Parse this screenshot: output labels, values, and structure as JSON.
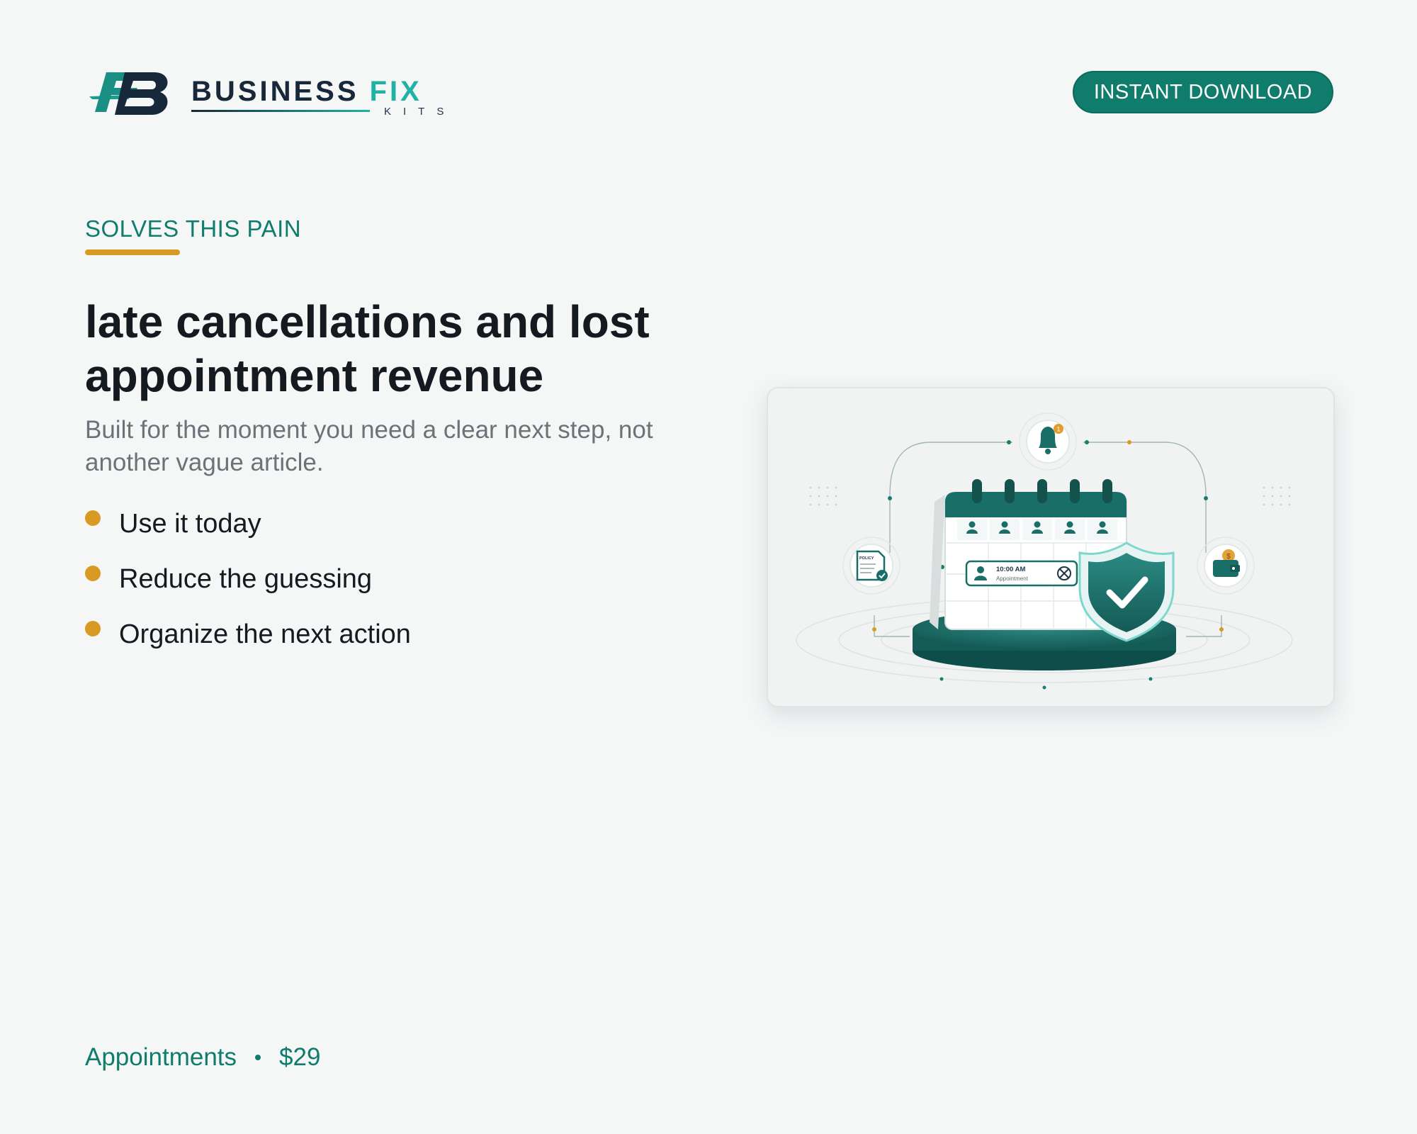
{
  "brand": {
    "word_primary": "BUSINESS",
    "word_accent": "FIX",
    "sub": "KITS",
    "colors": {
      "navy": "#16283a",
      "teal": "#21b2a6"
    }
  },
  "header": {
    "cta_label": "INSTANT DOWNLOAD"
  },
  "content": {
    "eyebrow": "SOLVES THIS PAIN",
    "headline": "late cancellations and lost appointment revenue",
    "subtext": "Built for the moment you need a clear next step, not another vague article.",
    "bullets": [
      {
        "label": "Use it today"
      },
      {
        "label": "Reduce the guessing"
      },
      {
        "label": "Organize the next action"
      }
    ]
  },
  "hero": {
    "appointment_time": "10:00 AM",
    "appointment_label": "Appointment",
    "policy_label": "POLICY",
    "bell_badge": "1",
    "coin_symbol": "$",
    "icons": [
      "bell-icon",
      "policy-document-icon",
      "wallet-icon",
      "shield-check-icon",
      "calendar-icon"
    ]
  },
  "footer": {
    "category": "Appointments",
    "price": "$29"
  },
  "colors": {
    "accent_teal": "#0f7c6c",
    "accent_gold": "#d89a22",
    "text_dark": "#141a20",
    "text_muted": "#6b7278"
  }
}
